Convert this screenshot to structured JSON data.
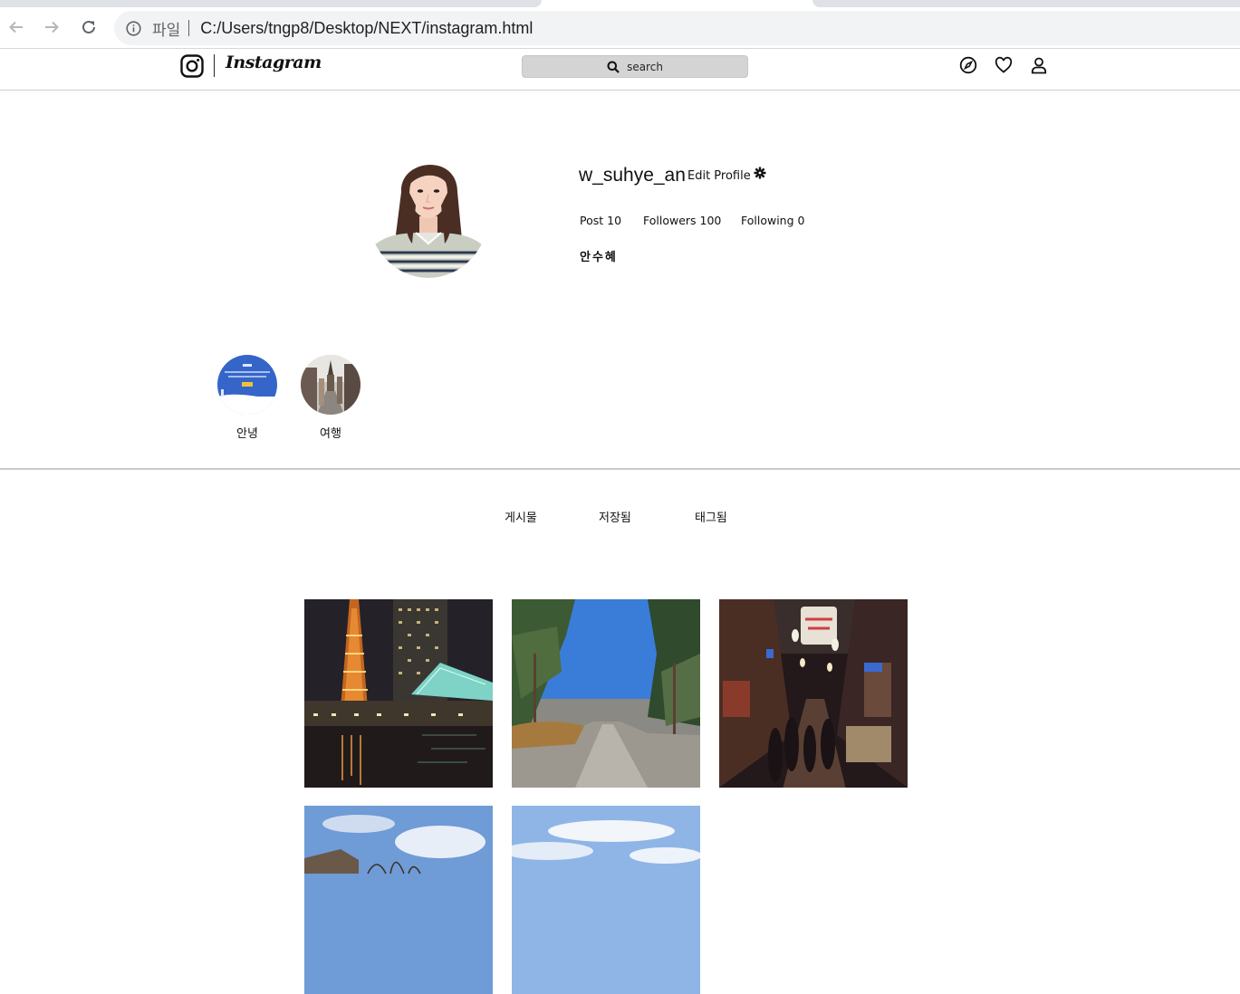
{
  "browser": {
    "scheme_label": "파일",
    "url": "C:/Users/tngp8/Desktop/NEXT/instagram.html"
  },
  "header": {
    "logo_text": "Instagram",
    "search_placeholder": "search"
  },
  "profile": {
    "username": "w_suhye_an",
    "edit_label": "Edit Profile",
    "stats": {
      "posts": "Post 10",
      "followers": "Followers 100",
      "following": "Following 0"
    },
    "full_name": "안수혜"
  },
  "highlights": [
    {
      "label": "안녕"
    },
    {
      "label": "여행"
    }
  ],
  "tabs": [
    {
      "label": "게시물"
    },
    {
      "label": "저장됨"
    },
    {
      "label": "태그됨"
    }
  ],
  "posts": [
    {
      "subject": "tower-night"
    },
    {
      "subject": "pine-road"
    },
    {
      "subject": "market-street"
    },
    {
      "subject": "sky-branches"
    },
    {
      "subject": "sky-clouds"
    }
  ],
  "colors": {
    "search_bg": "#d4d4d4",
    "highlight_blue": "#3565c9",
    "divider": "#c9c9c9"
  }
}
